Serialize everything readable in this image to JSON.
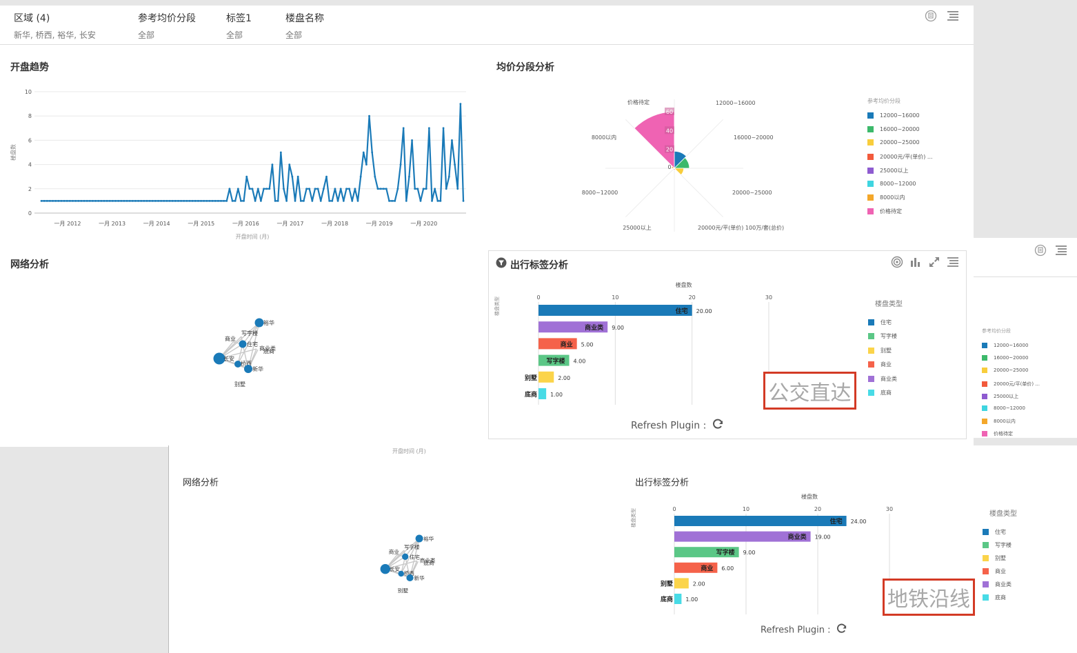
{
  "filters": [
    {
      "label": "区域 (4)",
      "value": "新华, 桥西, 裕华, 长安"
    },
    {
      "label": "参考均价分段",
      "value": "全部"
    },
    {
      "label": "标签1",
      "value": "全部"
    },
    {
      "label": "楼盘名称",
      "value": "全部"
    }
  ],
  "sections": {
    "trend": "开盘趋势",
    "price": "均价分段分析",
    "network": "网络分析",
    "tag": "出行标签分析"
  },
  "refresh_label": "Refresh Plugin :",
  "tag_overlay_1": "公交直达",
  "tag_overlay_2": "地铁沿线",
  "bottom_axis_caption": "开盘时间 (月)",
  "chart_data": [
    {
      "type": "line",
      "title": "开盘趋势",
      "xlabel": "开盘时间 (月)",
      "ylabel": "楼盘数",
      "ylim": [
        0,
        10
      ],
      "y_ticks": [
        0,
        2,
        4,
        6,
        8,
        10
      ],
      "x_ticks": [
        "一月 2012",
        "一月 2013",
        "一月 2014",
        "一月 2015",
        "一月 2016",
        "一月 2017",
        "一月 2018",
        "一月 2019",
        "一月 2020"
      ],
      "series": [
        {
          "color": "#1a7ab8",
          "values": [
            1,
            1,
            1,
            1,
            1,
            1,
            1,
            1,
            1,
            1,
            1,
            1,
            1,
            1,
            1,
            1,
            1,
            1,
            1,
            1,
            1,
            1,
            1,
            1,
            1,
            1,
            1,
            1,
            1,
            1,
            1,
            1,
            1,
            1,
            1,
            1,
            1,
            1,
            1,
            1,
            1,
            1,
            1,
            1,
            1,
            1,
            1,
            1,
            1,
            1,
            1,
            1,
            1,
            1,
            1,
            1,
            1,
            1,
            1,
            1,
            1,
            1,
            1,
            1,
            1,
            1,
            2,
            1,
            1,
            2,
            1,
            1,
            3,
            2,
            2,
            1,
            2,
            1,
            2,
            2,
            2,
            4,
            1,
            1,
            5,
            2,
            1,
            4,
            3,
            1,
            3,
            1,
            1,
            2,
            2,
            1,
            2,
            2,
            1,
            2,
            3,
            1,
            1,
            2,
            1,
            2,
            1,
            2,
            2,
            1,
            2,
            1,
            3,
            5,
            4,
            8,
            5,
            3,
            2,
            2,
            2,
            2,
            1,
            1,
            1,
            2,
            4,
            7,
            1,
            3,
            6,
            2,
            2,
            1,
            2,
            2,
            7,
            1,
            2,
            1,
            1,
            7,
            2,
            3,
            6,
            4,
            2,
            9,
            1
          ]
        }
      ]
    },
    {
      "type": "pie",
      "title": "均价分段分析",
      "legend_title": "参考均价分段",
      "radial_ticks": [
        0,
        20,
        40,
        60
      ],
      "categories": [
        "12000~16000",
        "16000~20000",
        "20000~25000",
        "20000元/平(单价) 100万/套(总价)",
        "25000以上",
        "8000~12000",
        "8000以内",
        "价格待定"
      ],
      "legend_labels": [
        "12000~16000",
        "16000~20000",
        "20000~25000",
        "20000元/平(单价) ...",
        "25000以上",
        "8000~12000",
        "8000以内",
        "价格待定"
      ],
      "values": [
        18,
        16,
        10,
        2,
        2,
        1,
        3,
        60
      ],
      "colors": [
        "#1a7ab8",
        "#3cb96b",
        "#f8cd3c",
        "#f25a3c",
        "#8e5bd0",
        "#3fd5e0",
        "#f4a72a",
        "#ef63b3"
      ]
    },
    {
      "type": "bar",
      "title": "出行标签分析",
      "xlabel": "楼盘数",
      "legend_title": "楼盘类型",
      "x_ticks": [
        0,
        10,
        20,
        30
      ],
      "categories": [
        "住宅",
        "商业类",
        "商业",
        "写字楼",
        "别墅",
        "底商"
      ],
      "values": [
        20,
        9,
        5,
        4,
        2,
        1
      ],
      "value_labels": [
        "20.00",
        "9.00",
        "5.00",
        "4.00",
        "2.00",
        "1.00"
      ],
      "colors": [
        "#1a7ab8",
        "#a071d6",
        "#f5624a",
        "#5bc786",
        "#fbd44a",
        "#48dbe6"
      ],
      "legend": [
        "住宅",
        "写字楼",
        "别墅",
        "商业",
        "商业类",
        "底商"
      ],
      "legend_colors": [
        "#1a7ab8",
        "#5bc786",
        "#fbd44a",
        "#f5624a",
        "#a071d6",
        "#48dbe6"
      ]
    },
    {
      "type": "bar",
      "title": "出行标签分析",
      "xlabel": "楼盘数",
      "legend_title": "楼盘类型",
      "x_ticks": [
        0,
        10,
        20,
        30
      ],
      "categories": [
        "住宅",
        "商业类",
        "写字楼",
        "商业",
        "别墅",
        "底商"
      ],
      "values": [
        24,
        19,
        9,
        6,
        2,
        1
      ],
      "value_labels": [
        "24.00",
        "19.00",
        "9.00",
        "6.00",
        "2.00",
        "1.00"
      ],
      "colors": [
        "#1a7ab8",
        "#a071d6",
        "#5bc786",
        "#f5624a",
        "#fbd44a",
        "#48dbe6"
      ],
      "legend": [
        "住宅",
        "写字楼",
        "别墅",
        "商业",
        "商业类",
        "底商"
      ],
      "legend_colors": [
        "#1a7ab8",
        "#5bc786",
        "#fbd44a",
        "#f5624a",
        "#a071d6",
        "#48dbe6"
      ]
    }
  ],
  "network": {
    "nodes": [
      "裕华",
      "写字楼",
      "商业",
      "住宅",
      "商业类",
      "底商",
      "长安",
      "桥西",
      "新华",
      "别墅"
    ]
  },
  "side_legend": {
    "title": "参考均价分段",
    "labels": [
      "12000~16000",
      "16000~20000",
      "20000~25000",
      "20000元/平(单价) ...",
      "25000以上",
      "8000~12000",
      "8000以内",
      "价格待定"
    ],
    "colors": [
      "#1a7ab8",
      "#3cb96b",
      "#f8cd3c",
      "#f25a3c",
      "#8e5bd0",
      "#3fd5e0",
      "#f4a72a",
      "#ef63b3"
    ]
  },
  "icons": [
    "report-icon",
    "menu-icon",
    "target-icon",
    "bar-chart-icon",
    "expand-icon",
    "filter-icon",
    "refresh-icon"
  ]
}
